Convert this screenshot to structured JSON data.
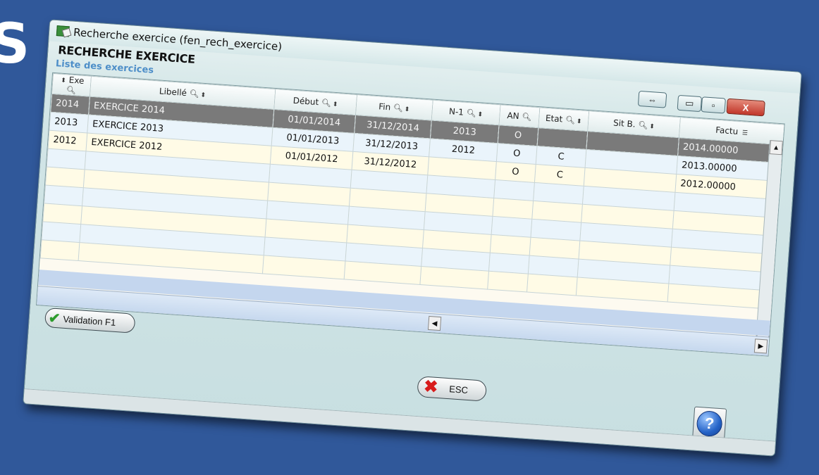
{
  "background_letter": "S",
  "window": {
    "title": "Recherche exercice (fen_rech_exercice)",
    "heading": "RECHERCHE EXERCICE",
    "list_title": "Liste des exercices",
    "controls": {
      "restore": "⇔",
      "minimize": "▭",
      "maximize": "▫",
      "close": "X"
    }
  },
  "grid": {
    "columns": [
      "Exe",
      "Libellé",
      "Début",
      "Fin",
      "N-1",
      "AN",
      "Etat",
      "Sit B.",
      "Factu"
    ],
    "rows": [
      {
        "exe": "2014",
        "libelle": "EXERCICE 2014",
        "debut": "01/01/2014",
        "fin": "31/12/2014",
        "n1": "2013",
        "an": "O",
        "etat": "",
        "sitb": "",
        "factu": "2014.00000"
      },
      {
        "exe": "2013",
        "libelle": "EXERCICE 2013",
        "debut": "01/01/2013",
        "fin": "31/12/2013",
        "n1": "2012",
        "an": "O",
        "etat": "C",
        "sitb": "",
        "factu": "2013.00000"
      },
      {
        "exe": "2012",
        "libelle": "EXERCICE 2012",
        "debut": "01/01/2012",
        "fin": "31/12/2012",
        "n1": "",
        "an": "O",
        "etat": "C",
        "sitb": "",
        "factu": "2012.00000"
      }
    ],
    "selected_row": 0
  },
  "buttons": {
    "validation": "Validation F1",
    "esc": "ESC",
    "help": "?"
  },
  "colors": {
    "desktop": "#30589a",
    "selected_row": "#7a7a7a",
    "list_title": "#4d8ec8"
  }
}
